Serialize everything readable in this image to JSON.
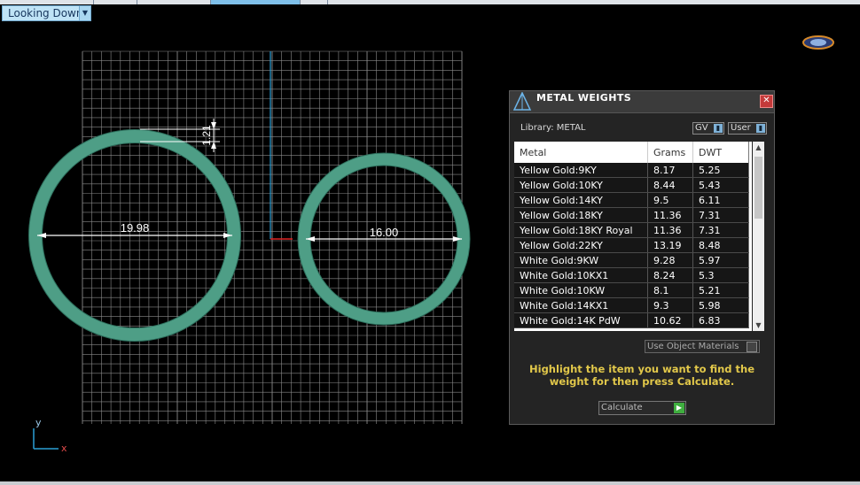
{
  "view": {
    "dropdown_label": "Looking Down",
    "dropdown_arrow": "chevron-down-icon"
  },
  "dimensions": {
    "left_diameter": "19.98",
    "right_diameter": "16.00",
    "thickness": "1.21"
  },
  "axes": {
    "y": "y",
    "x": "x"
  },
  "panel": {
    "title": "METAL WEIGHTS",
    "close_icon": "close-icon",
    "library_label": "Library: METAL",
    "toggle_gv": "GV",
    "toggle_user": "User",
    "columns": [
      "Metal",
      "Grams",
      "DWT"
    ],
    "rows": [
      [
        "Yellow Gold:9KY",
        "8.17",
        "5.25"
      ],
      [
        "Yellow Gold:10KY",
        "8.44",
        "5.43"
      ],
      [
        "Yellow Gold:14KY",
        "9.5",
        "6.11"
      ],
      [
        "Yellow Gold:18KY",
        "11.36",
        "7.31"
      ],
      [
        "Yellow Gold:18KY Royal",
        "11.36",
        "7.31"
      ],
      [
        "Yellow Gold:22KY",
        "13.19",
        "8.48"
      ],
      [
        "White Gold:9KW",
        "9.28",
        "5.97"
      ],
      [
        "White Gold:10KX1",
        "8.24",
        "5.3"
      ],
      [
        "White Gold:10KW",
        "8.1",
        "5.21"
      ],
      [
        "White Gold:14KX1",
        "9.3",
        "5.98"
      ],
      [
        "White Gold:14K PdW",
        "10.62",
        "6.83"
      ]
    ],
    "use_object_materials": "Use Object Materials",
    "hint": "Highlight the item you want to find the weight for then press Calculate.",
    "calculate": "Calculate"
  },
  "colors": {
    "ring": "#4e9e86",
    "grid": "#a8a8a8",
    "hint": "#e2c84a",
    "accent": "#bfe3f6"
  }
}
